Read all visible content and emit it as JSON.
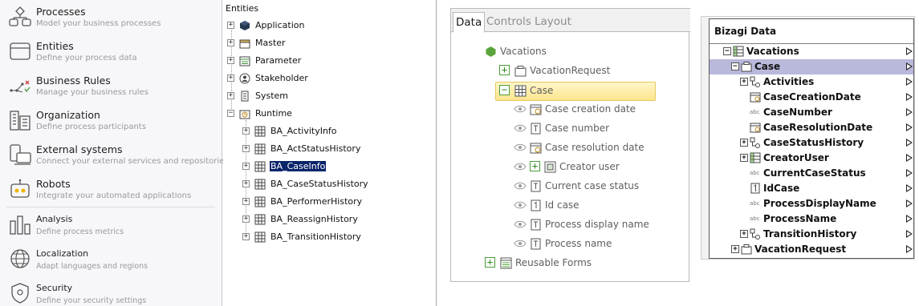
{
  "nav": {
    "items": [
      {
        "title": "Processes",
        "desc": "Model your business processes",
        "icon": "processes-icon"
      },
      {
        "title": "Entities",
        "desc": "Define your process data",
        "icon": "entities-icon"
      },
      {
        "title": "Business Rules",
        "desc": "Manage your business rules",
        "icon": "business-rules-icon"
      },
      {
        "title": "Organization",
        "desc": "Define process participants",
        "icon": "organization-icon"
      },
      {
        "title": "External systems",
        "desc": "Connect your external services and repositories",
        "icon": "external-systems-icon"
      },
      {
        "title": "Robots",
        "desc": "Integrate your automated applications",
        "icon": "robots-icon"
      },
      {
        "title": "Analysis",
        "desc": "Define process metrics",
        "icon": "analysis-icon"
      },
      {
        "title": "Localization",
        "desc": "Adapt languages and regions",
        "icon": "localization-icon"
      },
      {
        "title": "Security",
        "desc": "Define your security settings",
        "icon": "security-icon"
      }
    ]
  },
  "entities": {
    "header": "Entities",
    "roots": [
      {
        "label": "Application",
        "icon": "application-cube-icon",
        "expander": "+"
      },
      {
        "label": "Master",
        "icon": "master-entity-icon",
        "expander": "+"
      },
      {
        "label": "Parameter",
        "icon": "parameter-entity-icon",
        "expander": "+"
      },
      {
        "label": "Stakeholder",
        "icon": "stakeholder-icon",
        "expander": "+"
      },
      {
        "label": "System",
        "icon": "system-icon",
        "expander": "+"
      },
      {
        "label": "Runtime",
        "icon": "runtime-icon",
        "expander": "−"
      }
    ],
    "runtime_children": [
      {
        "label": "BA_ActivityInfo",
        "expander": "+"
      },
      {
        "label": "BA_ActStatusHistory",
        "expander": "+"
      },
      {
        "label": "BA_CaseInfo",
        "expander": "+",
        "selected": true
      },
      {
        "label": "BA_CaseStatusHistory",
        "expander": "+"
      },
      {
        "label": "BA_PerformerHistory",
        "expander": "+"
      },
      {
        "label": "BA_ReassignHistory",
        "expander": "+"
      },
      {
        "label": "BA_TransitionHistory",
        "expander": "+"
      }
    ]
  },
  "data_panel": {
    "tabs": [
      {
        "label": "Data",
        "active": true
      },
      {
        "label": "Controls",
        "active": false
      },
      {
        "label": "Layout",
        "active": false
      }
    ],
    "root": "Vacations",
    "vacation_request": "VacationRequest",
    "case": "Case",
    "case_children": [
      {
        "label": "Case creation date",
        "icon": "date-field-icon"
      },
      {
        "label": "Case number",
        "icon": "text-field-icon"
      },
      {
        "label": "Case resolution date",
        "icon": "date-field-icon"
      },
      {
        "label": "Creator user",
        "icon": "relation-field-icon",
        "expandable": true
      },
      {
        "label": "Current case status",
        "icon": "text-field-icon"
      },
      {
        "label": "Id case",
        "icon": "number-field-icon"
      },
      {
        "label": "Process display name",
        "icon": "text-field-icon"
      },
      {
        "label": "Process name",
        "icon": "text-field-icon"
      }
    ],
    "reusable_forms": "Reusable Forms"
  },
  "bizagi": {
    "title": "Bizagi Data",
    "rows": [
      {
        "label": "Vacations",
        "level": 0,
        "expander": "−",
        "icon": "table-icon"
      },
      {
        "label": "Case",
        "level": 1,
        "expander": "−",
        "icon": "entity-icon",
        "selected": true
      },
      {
        "label": "Activities",
        "level": 2,
        "expander": "+",
        "icon": "collection-icon"
      },
      {
        "label": "CaseCreationDate",
        "level": 2,
        "expander": "",
        "icon": "date-icon"
      },
      {
        "label": "CaseNumber",
        "level": 2,
        "expander": "",
        "icon": "abc-icon"
      },
      {
        "label": "CaseResolutionDate",
        "level": 2,
        "expander": "",
        "icon": "date-icon"
      },
      {
        "label": "CaseStatusHistory",
        "level": 2,
        "expander": "+",
        "icon": "collection-icon"
      },
      {
        "label": "CreatorUser",
        "level": 2,
        "expander": "+",
        "icon": "table-icon"
      },
      {
        "label": "CurrentCaseStatus",
        "level": 2,
        "expander": "",
        "icon": "abc-icon"
      },
      {
        "label": "IdCase",
        "level": 2,
        "expander": "",
        "icon": "number-icon"
      },
      {
        "label": "ProcessDisplayName",
        "level": 2,
        "expander": "",
        "icon": "abc-icon"
      },
      {
        "label": "ProcessName",
        "level": 2,
        "expander": "",
        "icon": "abc-icon"
      },
      {
        "label": "TransitionHistory",
        "level": 2,
        "expander": "+",
        "icon": "collection-icon"
      },
      {
        "label": "VacationRequest",
        "level": 1,
        "expander": "+",
        "icon": "entity-icon"
      }
    ],
    "abc_text": "abc"
  },
  "colors": {
    "selection": "#0a246a",
    "case_highlight": "#fde58c",
    "bizagi_selection": "#b9b9dc",
    "green_accent": "#5aa43c"
  }
}
